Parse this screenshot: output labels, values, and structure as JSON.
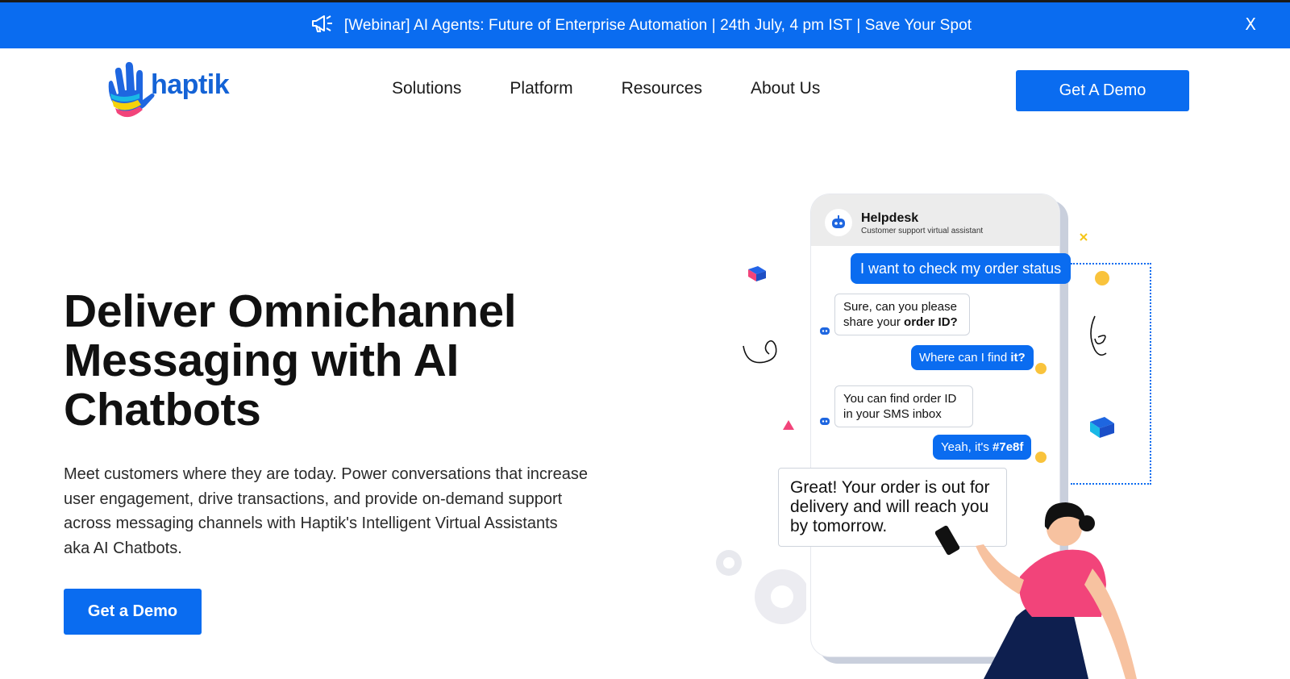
{
  "banner": {
    "text": "[Webinar] AI Agents: Future of Enterprise Automation | 24th July, 4 pm IST | Save Your Spot",
    "close_label": "X",
    "icon": "megaphone-icon"
  },
  "logo": {
    "text": "haptik"
  },
  "nav": {
    "items": [
      {
        "label": "Solutions"
      },
      {
        "label": "Platform"
      },
      {
        "label": "Resources"
      },
      {
        "label": "About Us"
      }
    ],
    "cta_label": "Get A Demo"
  },
  "hero": {
    "title": "Deliver Omnichannel Messaging with AI Chatbots",
    "description": "Meet customers where they are today. Power conversations that increase user engagement, drive transactions, and provide on-demand support across messaging channels with Haptik's Intelligent Virtual Assistants aka AI Chatbots.",
    "cta_label": "Get a Demo"
  },
  "chat": {
    "title": "Helpdesk",
    "subtitle": "Customer support virtual assistant",
    "messages": [
      {
        "from": "user",
        "text": "I want to check my order status"
      },
      {
        "from": "bot",
        "text": "Sure, can you please share your",
        "bold": "order ID?"
      },
      {
        "from": "user",
        "text": "Where can I find",
        "bold": "it?"
      },
      {
        "from": "bot",
        "text": "You can find order ID in your SMS inbox"
      },
      {
        "from": "user",
        "text": "Yeah, it's",
        "bold": "#7e8f"
      },
      {
        "from": "bot",
        "text": "Great! Your order is out for delivery and will reach you by tomorrow."
      }
    ]
  },
  "colors": {
    "brand_blue": "#0a6cf0",
    "accent_pink": "#f2447a"
  }
}
